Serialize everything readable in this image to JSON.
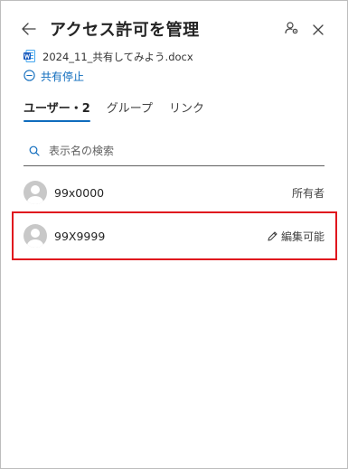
{
  "header": {
    "title": "アクセス許可を管理",
    "back_icon": "arrow-left-icon",
    "manage_icon": "person-settings-icon",
    "close_icon": "close-icon"
  },
  "file": {
    "name": "2024_11_共有してみよう.docx",
    "icon": "word-doc-icon",
    "icon_color": "#185abd"
  },
  "stop_share": {
    "label": "共有停止",
    "icon": "minus-circle-icon",
    "color": "#0f6cbd"
  },
  "tabs": [
    {
      "label": "ユーザー・2",
      "active": true
    },
    {
      "label": "グループ",
      "active": false
    },
    {
      "label": "リンク",
      "active": false
    }
  ],
  "search": {
    "placeholder": "表示名の検索",
    "value": ""
  },
  "users": [
    {
      "name": "99x0000",
      "role": "所有者",
      "editable": false
    },
    {
      "name": "99X9999",
      "role": "編集可能",
      "editable": true
    }
  ],
  "highlight_color": "#e0161e"
}
